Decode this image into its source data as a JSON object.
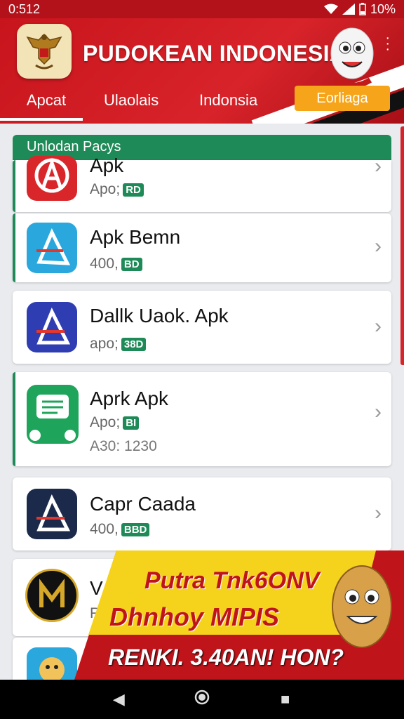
{
  "status_bar": {
    "time": "0:512",
    "battery": "10%"
  },
  "header": {
    "title": "PUDOKEAN INDONESIA",
    "tabs": [
      {
        "label": "Apcat"
      },
      {
        "label": "Ulaolais"
      },
      {
        "label": "Indonsia"
      },
      {
        "label": "Eorliaga"
      }
    ]
  },
  "section": {
    "title": "Unlodan Pacys"
  },
  "apps": [
    {
      "name": "Apk",
      "meta": "Apo;",
      "badge": "RD",
      "icon": "red-a-logo-icon"
    },
    {
      "name": "Apk Bemn",
      "meta": "400,",
      "badge": "BD",
      "icon": "blue-a-logo-icon"
    },
    {
      "name": "Dallk Uaok. Apk",
      "meta": "apo;",
      "badge": "38D",
      "icon": "navy-a-logo-icon"
    },
    {
      "name": "Aprk Apk",
      "meta": "Apo;",
      "badge": "BI",
      "meta2": "A30: 1230",
      "icon": "green-chat-logo-icon"
    },
    {
      "name": "Capr Caada",
      "meta": "400,",
      "badge": "BBD",
      "icon": "dark-a-logo-icon"
    },
    {
      "name": "V",
      "meta": "R",
      "icon": "m-coin-logo-icon"
    }
  ],
  "promo": {
    "line1": "Putra Tnk6ONV",
    "line2": "Dhnhoy MIPIS",
    "line3": "RENKI. 3.40AN! HON?"
  }
}
